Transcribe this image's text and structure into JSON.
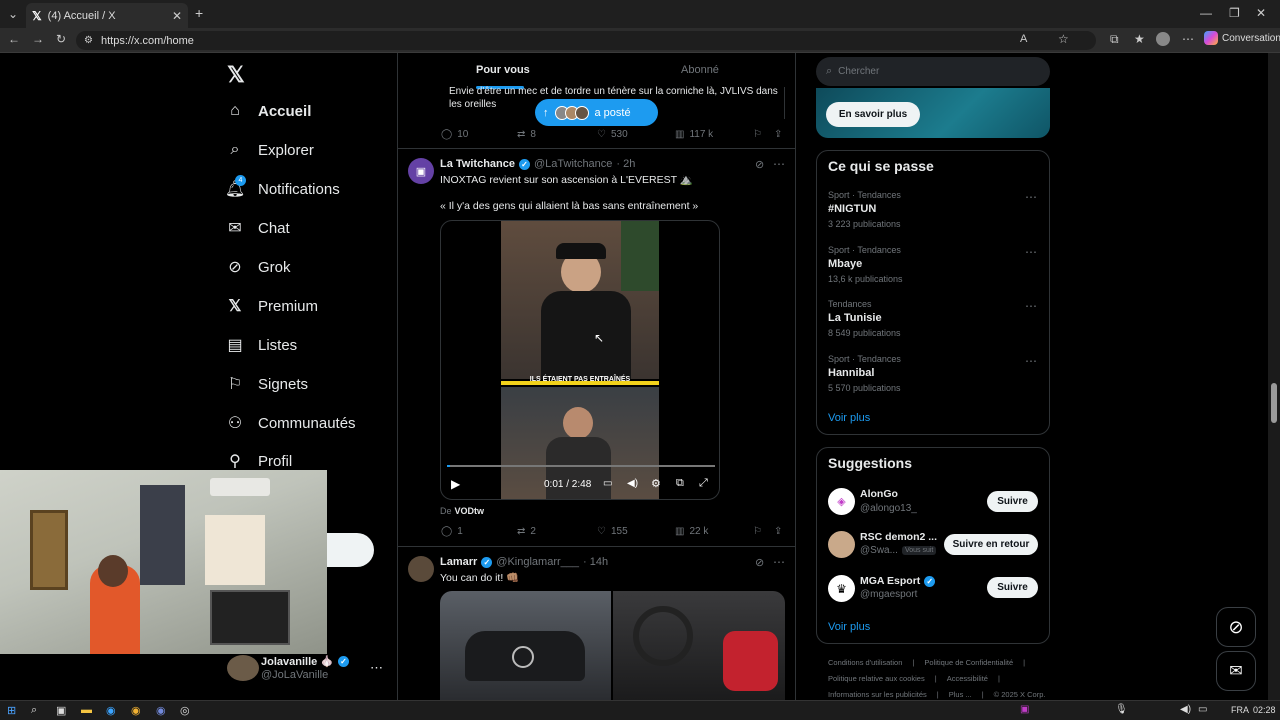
{
  "browser": {
    "tab_title": "(4) Accueil / X",
    "url": "https://x.com/home",
    "copilot_label": "Conversation"
  },
  "nav": {
    "items": [
      {
        "label": "Accueil",
        "icon": "home-icon"
      },
      {
        "label": "Explorer",
        "icon": "search-icon"
      },
      {
        "label": "Notifications",
        "icon": "bell-icon",
        "badge": "4"
      },
      {
        "label": "Chat",
        "icon": "mail-icon"
      },
      {
        "label": "Grok",
        "icon": "grok-icon"
      },
      {
        "label": "Premium",
        "icon": "x-logo-icon"
      },
      {
        "label": "Listes",
        "icon": "list-icon"
      },
      {
        "label": "Signets",
        "icon": "bookmark-icon"
      },
      {
        "label": "Communautés",
        "icon": "communities-icon"
      },
      {
        "label": "Profil",
        "icon": "profile-icon"
      }
    ],
    "account": {
      "name": "Jolavanille 🧄",
      "handle": "@JoLaVanille"
    }
  },
  "timeline": {
    "tabs": {
      "for_you": "Pour vous",
      "following": "Abonné"
    },
    "new_posts_pill": "a posté",
    "prev_post": {
      "text": "Envie d'être un mec et de tordre un ténère sur la corniche là, JVLIVS dans les oreilles",
      "replies": "10",
      "reposts": "8",
      "likes": "530",
      "views": "117 k"
    },
    "post1": {
      "name": "La Twitchance",
      "handle": "@LaTwitchance",
      "time": "· 2h",
      "line1": "INOXTAG revient sur son ascension à L'EVEREST ⛰️",
      "line2": "« Il y'a des gens qui allaient là bas sans entraînement »",
      "video_caption": "ILS ÉTAIENT PAS ENTRAÎNÉS",
      "video_time": "0:01 / 2:48",
      "source_prefix": "De",
      "source": "VODtw",
      "replies": "1",
      "reposts": "2",
      "likes": "155",
      "views": "22 k"
    },
    "post2": {
      "name": "Lamarr",
      "handle": "@Kinglamarr___",
      "time": "· 14h",
      "text": "You can do it! 👊🏽"
    }
  },
  "right": {
    "search_placeholder": "Chercher",
    "promo_button": "En savoir plus",
    "trends_title": "Ce qui se passe",
    "trends": [
      {
        "meta": "Sport · Tendances",
        "title": "#NIGTUN",
        "count": "3 223 publications"
      },
      {
        "meta": "Sport · Tendances",
        "title": "Mbaye",
        "count": "13,6 k publications"
      },
      {
        "meta": "Tendances",
        "title": "La Tunisie",
        "count": "8 549 publications"
      },
      {
        "meta": "Sport · Tendances",
        "title": "Hannibal",
        "count": "5 570 publications"
      }
    ],
    "trends_more": "Voir plus",
    "suggestions_title": "Suggestions",
    "suggestions": [
      {
        "name": "AlonGo",
        "handle": "@alongo13_",
        "button": "Suivre"
      },
      {
        "name": "RSC demon2 ...",
        "handle": "@Swa...",
        "badge": "Vous suit",
        "button": "Suivre en retour"
      },
      {
        "name": "MGA Esport",
        "handle": "@mgaesport",
        "button": "Suivre"
      }
    ],
    "suggestions_more": "Voir plus",
    "footer": {
      "l1a": "Conditions d'utilisation",
      "l1b": "Politique de Confidentialité",
      "l2a": "Politique relative aux cookies",
      "l2b": "Accessibilité",
      "l3a": "Informations sur les publicités",
      "l3b": "Plus ...",
      "l3c": "© 2025 X Corp."
    }
  },
  "taskbar": {
    "lang": "FRA",
    "time": "02:28"
  },
  "colors": {
    "accent": "#1d9bf0",
    "bg": "#000000",
    "border": "#2f3336",
    "muted": "#71767b"
  }
}
